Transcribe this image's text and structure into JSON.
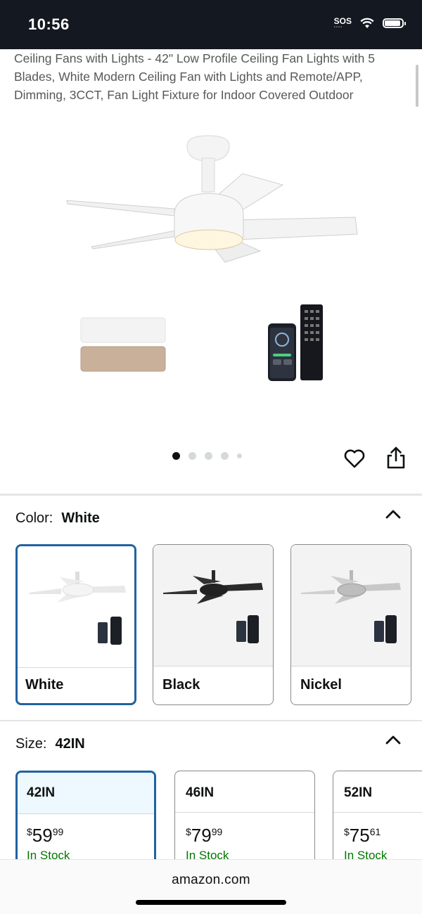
{
  "status": {
    "time": "10:56",
    "sos": "SOS"
  },
  "product": {
    "title": "Ceiling Fans with Lights - 42\" Low Profile Ceiling Fan Lights with 5 Blades, White Modern Ceiling Fan with Lights and Remote/APP, Dimming, 3CCT, Fan Light Fixture for Indoor Covered Outdoor",
    "image_index": 1,
    "image_count": 5
  },
  "color": {
    "label": "Color:",
    "selected": "White",
    "options": [
      {
        "name": "White",
        "fan_color": "#ffffff",
        "selected": true
      },
      {
        "name": "Black",
        "fan_color": "#2a2a2a",
        "selected": false
      },
      {
        "name": "Nickel",
        "fan_color": "#c0c0c0",
        "selected": false
      }
    ]
  },
  "size": {
    "label": "Size:",
    "selected": "42IN",
    "options": [
      {
        "size": "42IN",
        "currency": "$",
        "whole": "59",
        "fraction": "99",
        "availability": "In Stock",
        "selected": true
      },
      {
        "size": "46IN",
        "currency": "$",
        "whole": "79",
        "fraction": "99",
        "availability": "In Stock",
        "selected": false
      },
      {
        "size": "52IN",
        "currency": "$",
        "whole": "75",
        "fraction": "61",
        "availability": "In Stock",
        "selected": false
      }
    ]
  },
  "browser": {
    "domain": "amazon.com"
  },
  "colors": {
    "accent": "#2162a1",
    "in_stock": "#007600",
    "status_bar": "#141821"
  }
}
